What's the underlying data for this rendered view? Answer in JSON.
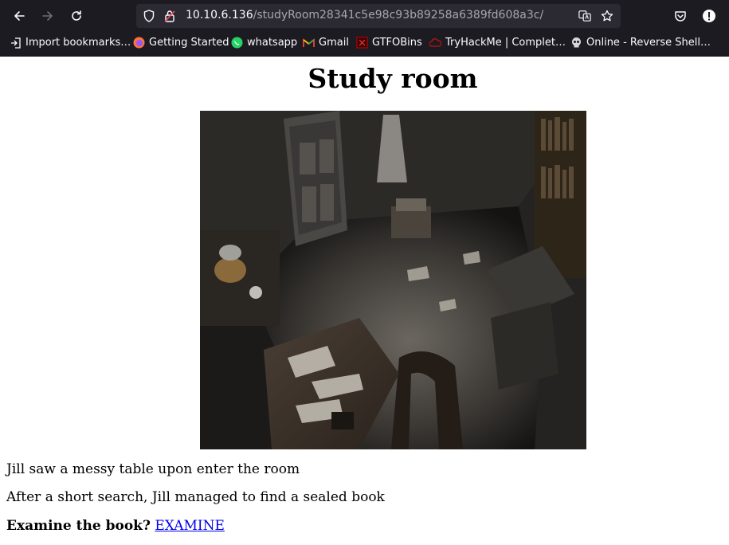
{
  "browser": {
    "url_host": "10.10.6.136",
    "url_path": "/studyRoom28341c5e98c93b89258a6389fd608a3c/",
    "bookmarks": [
      {
        "label": "Import bookmarks…",
        "icon": "import-icon"
      },
      {
        "label": "Getting Started",
        "icon": "firefox-icon"
      },
      {
        "label": "whatsapp",
        "icon": "whatsapp-icon"
      },
      {
        "label": "Gmail",
        "icon": "gmail-icon"
      },
      {
        "label": "GTFOBins",
        "icon": "gtfobins-icon"
      },
      {
        "label": "TryHackMe | Complet…",
        "icon": "tryhackme-icon"
      },
      {
        "label": "Online - Reverse Shell…",
        "icon": "skull-icon"
      }
    ]
  },
  "page": {
    "title": "Study room",
    "line1": "Jill saw a messy table upon enter the room",
    "line2": "After a short search, Jill managed to find a sealed book",
    "question": "Examine the book?",
    "link_label": "EXAMINE"
  },
  "colors": {
    "chrome_bg": "#1c1b22",
    "urlbar_bg": "#2b2a33",
    "link": "#0000ee"
  }
}
